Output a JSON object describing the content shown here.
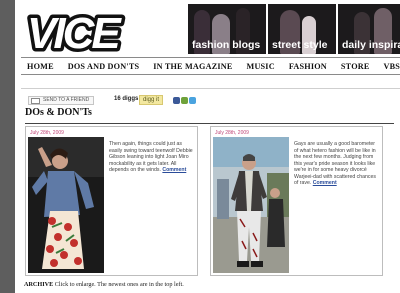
{
  "header": {
    "logo_text": "VICE",
    "banner": {
      "items": [
        "fashion blogs",
        "street style",
        "daily inspira"
      ]
    }
  },
  "nav": {
    "items": [
      "HOME",
      "DOS AND DON'TS",
      "IN THE MAGAZINE",
      "MUSIC",
      "FASHION",
      "STORE",
      "VBS.TV"
    ]
  },
  "share": {
    "send_label": "SEND TO A FRIEND",
    "diggs_label": "16 diggs",
    "digg_button": "digg it"
  },
  "section": {
    "title": "DOs & DON'Ts"
  },
  "entries": [
    {
      "date": "July 28th, 2009",
      "text": "Then again, things could just as easily swing toward teenwolf Debbie Gibson leaning into light Joan Miro mockability as it gets later. All depends on the winds.",
      "comment_label": "Comment"
    },
    {
      "date": "July 28th, 2009",
      "text": "Gays are usually a good barometer of what hetero fashion will be like in the next few months. Judging from this year's pride season it looks like we're in for some heavy divorcé Warjeei-dad with scattered chances of rave.",
      "comment_label": "Comment"
    }
  ],
  "archive": {
    "label": "ARCHIVE",
    "text": "Click to enlarge. The newest ones are in the top left."
  },
  "colors": {
    "date_pink": "#c04878",
    "link_blue": "#2a4c9a",
    "page_bg": "#5e5e5e"
  }
}
